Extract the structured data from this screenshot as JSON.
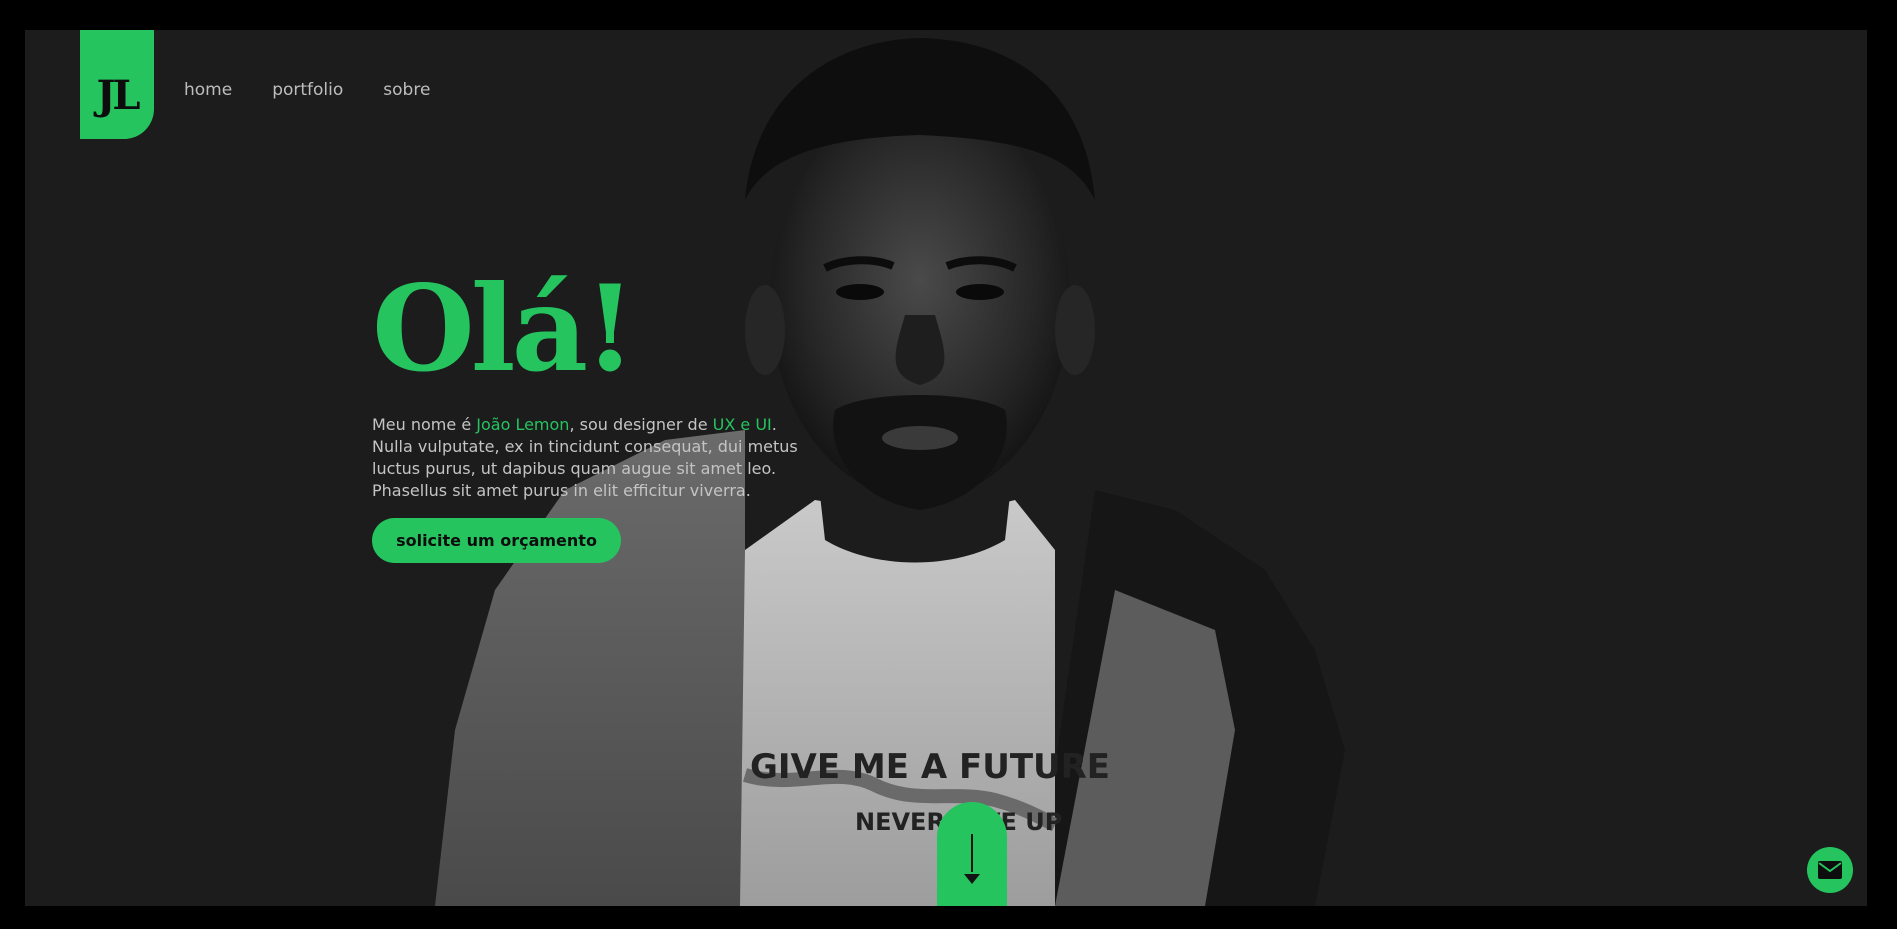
{
  "logo": {
    "text": "JL"
  },
  "nav": {
    "items": [
      {
        "label": "home"
      },
      {
        "label": "portfolio"
      },
      {
        "label": "sobre"
      }
    ]
  },
  "hero": {
    "title": "Olá!",
    "intro_1": "Meu nome é ",
    "name": "João Lemon",
    "intro_2": ", sou designer de ",
    "skills": "UX e UI",
    "intro_3": ". Nulla vulputate, ex in tincidunt consequat, dui metus luctus purus, ut dapibus quam augue sit amet leo. Phasellus sit amet purus in elit efficitur viverra.",
    "cta_label": "solicite um orçamento"
  },
  "photo": {
    "shirt_line_1": "GIVE ME A FUTURE",
    "shirt_line_2": "NEVER GIVE UP"
  },
  "icons": {
    "scroll": "arrow-down-icon",
    "contact": "mail-icon"
  },
  "colors": {
    "accent": "#25c45f",
    "background": "#1c1c1c",
    "frame": "#000000"
  }
}
